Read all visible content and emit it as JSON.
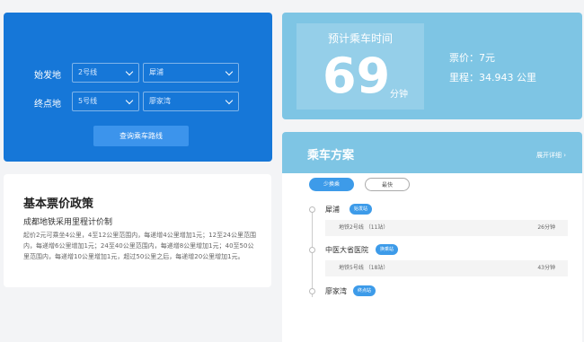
{
  "query": {
    "origin_label": "始发地",
    "origin_line": "2号线",
    "origin_station": "犀浦",
    "dest_label": "终点地",
    "dest_line": "5号线",
    "dest_station": "廖家湾",
    "button_label": "查询乘车路线"
  },
  "policy": {
    "title": "基本票价政策",
    "subtitle": "成都地铁采用里程计价制",
    "text": "起价2元可乘坐4公里，4至12公里范围内，每递增4公里增加1元；12至24公里范围内，每递增6公里增加1元；24至40公里范围内，每递增8公里增加1元；40至50公里范围内，每递增10公里增加1元，超过50公里之后，每递增20公里增加1元。"
  },
  "time": {
    "label": "预计乘车时间",
    "minutes": "69",
    "unit": "分钟",
    "fare": "票价：7元",
    "distance": "里程：34.943 公里"
  },
  "plan": {
    "title": "乘车方案",
    "expand": "展开详细 ›",
    "tab_few": "少换乘",
    "tab_fast": "最快",
    "stops": [
      {
        "name": "犀浦",
        "badge": "始发站"
      },
      {
        "name": "中医大省医院",
        "badge": "换乘站"
      },
      {
        "name": "廖家湾",
        "badge": "终点站"
      }
    ],
    "segments": [
      {
        "line": "地铁2号线 （11站）",
        "time": "26分钟"
      },
      {
        "line": "地铁5号线 （18站）",
        "time": "43分钟"
      }
    ]
  },
  "colors": {
    "primary": "#1677d8",
    "light_blue": "#7ec5e4",
    "badge": "#3d9be9"
  }
}
